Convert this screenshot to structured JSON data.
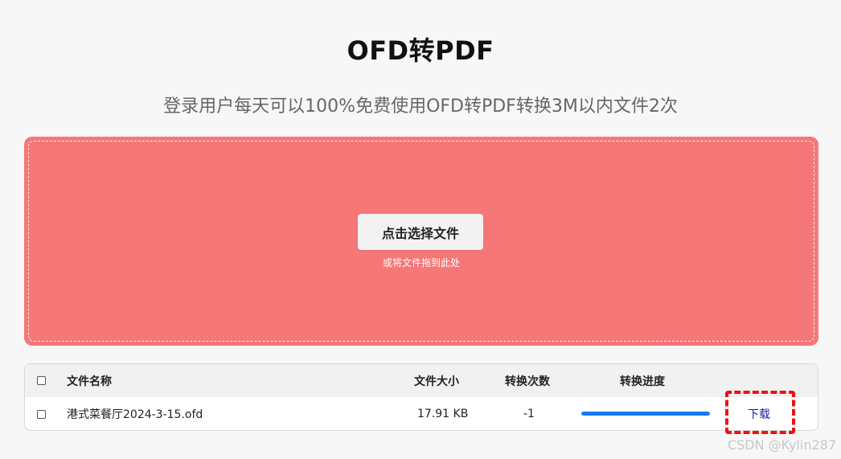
{
  "page": {
    "title": "OFD转PDF",
    "subtitle": "登录用户每天可以100%免费使用OFD转PDF转换3M以内文件2次"
  },
  "dropzone": {
    "button_label": "点击选择文件",
    "hint": "或将文件拖到此处",
    "color": "#f67777"
  },
  "table": {
    "headers": {
      "name": "文件名称",
      "size": "文件大小",
      "count": "转换次数",
      "progress": "转换进度"
    },
    "rows": [
      {
        "name": "港式菜餐厅2024-3-15.ofd",
        "size": "17.91 KB",
        "count": "-1",
        "progress": 1.0,
        "action": "下载"
      }
    ]
  },
  "colors": {
    "progress": "#1677ff",
    "highlight": "#ee1111"
  },
  "watermark": "CSDN @Kylin287"
}
